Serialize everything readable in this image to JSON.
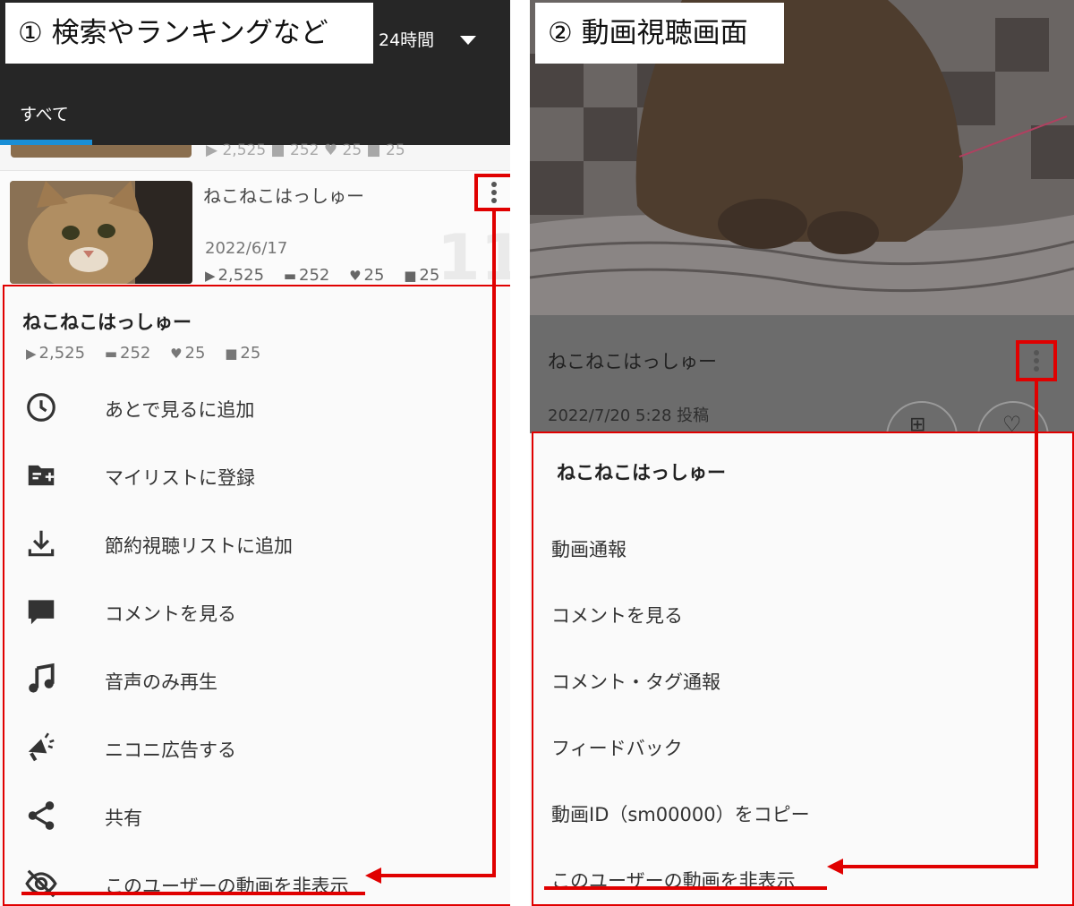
{
  "panel1": {
    "caption": "① 検索やランキングなど",
    "period_label": "24時間",
    "tab_label": "すべて",
    "prev_stats": "▶ 2,525  ■ 252  ♥ 25  ■ 25",
    "row": {
      "title": "ねこねこはっしゅー",
      "date": "2022/6/17",
      "rank": "11",
      "stats": {
        "views": "2,525",
        "comments": "252",
        "likes": "25",
        "mylists": "25"
      }
    },
    "sheet": {
      "title": "ねこねこはっしゅー",
      "stats": {
        "views": "2,525",
        "comments": "252",
        "likes": "25",
        "mylists": "25"
      },
      "items": [
        {
          "label": "あとで見るに追加",
          "icon": "clock-icon"
        },
        {
          "label": "マイリストに登録",
          "icon": "playlist-add-icon"
        },
        {
          "label": "節約視聴リストに追加",
          "icon": "download-icon"
        },
        {
          "label": "コメントを見る",
          "icon": "comment-icon"
        },
        {
          "label": "音声のみ再生",
          "icon": "music-note-icon"
        },
        {
          "label": "ニコニ広告する",
          "icon": "megaphone-icon"
        },
        {
          "label": "共有",
          "icon": "share-icon"
        },
        {
          "label": "このユーザーの動画を非表示",
          "icon": "eye-off-icon"
        }
      ]
    }
  },
  "panel2": {
    "caption": "② 動画視聴画面",
    "title": "ねこねこはっしゅー",
    "posted": "2022/7/20 5:28 投稿",
    "sheet": {
      "title": "ねこねこはっしゅー",
      "items": [
        {
          "label": "動画通報"
        },
        {
          "label": "コメントを見る"
        },
        {
          "label": "コメント・タグ通報"
        },
        {
          "label": "フィードバック"
        },
        {
          "label": "動画ID（sm00000）をコピー"
        },
        {
          "label": "このユーザーの動画を非表示"
        }
      ]
    }
  },
  "colors": {
    "highlight": "#e00000",
    "tab_accent": "#1a8fd6",
    "header_bg": "#262626"
  }
}
